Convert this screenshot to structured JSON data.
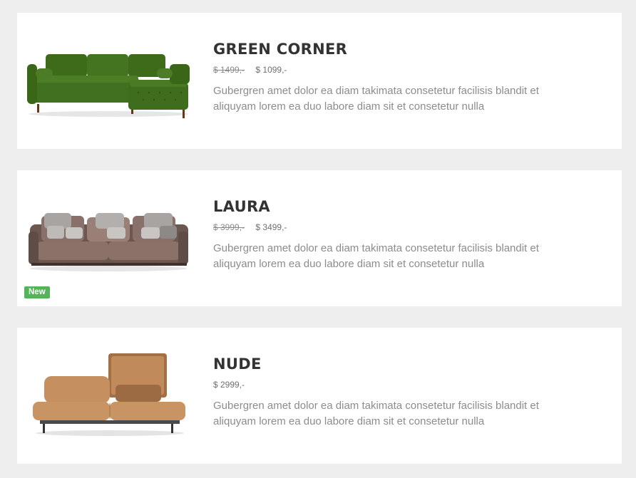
{
  "products": [
    {
      "name": "GREEN CORNER",
      "old_price": "$ 1499,-",
      "price": "$ 1099,-",
      "description": "Gubergren amet dolor ea diam takimata consetetur facilisis blandit et aliquyam lorem ea duo labore diam sit et consetetur nulla",
      "image": "green-corner-sofa",
      "color": "#3f6d1c"
    },
    {
      "name": "LAURA",
      "old_price": "$ 3999,-",
      "price": "$ 3499,-",
      "description": "Gubergren amet dolor ea diam takimata consetetur facilisis blandit et aliquyam lorem ea duo labore diam sit et consetetur nulla",
      "image": "laura-sofa",
      "color": "#7e6760",
      "badge": "New",
      "badge_color": "#56b35a"
    },
    {
      "name": "NUDE",
      "price": "$ 2999,-",
      "description": "Gubergren amet dolor ea diam takimata consetetur facilisis blandit et aliquyam lorem ea duo labore diam sit et consetetur nulla",
      "image": "nude-sofa",
      "color": "#c08a5b"
    }
  ]
}
